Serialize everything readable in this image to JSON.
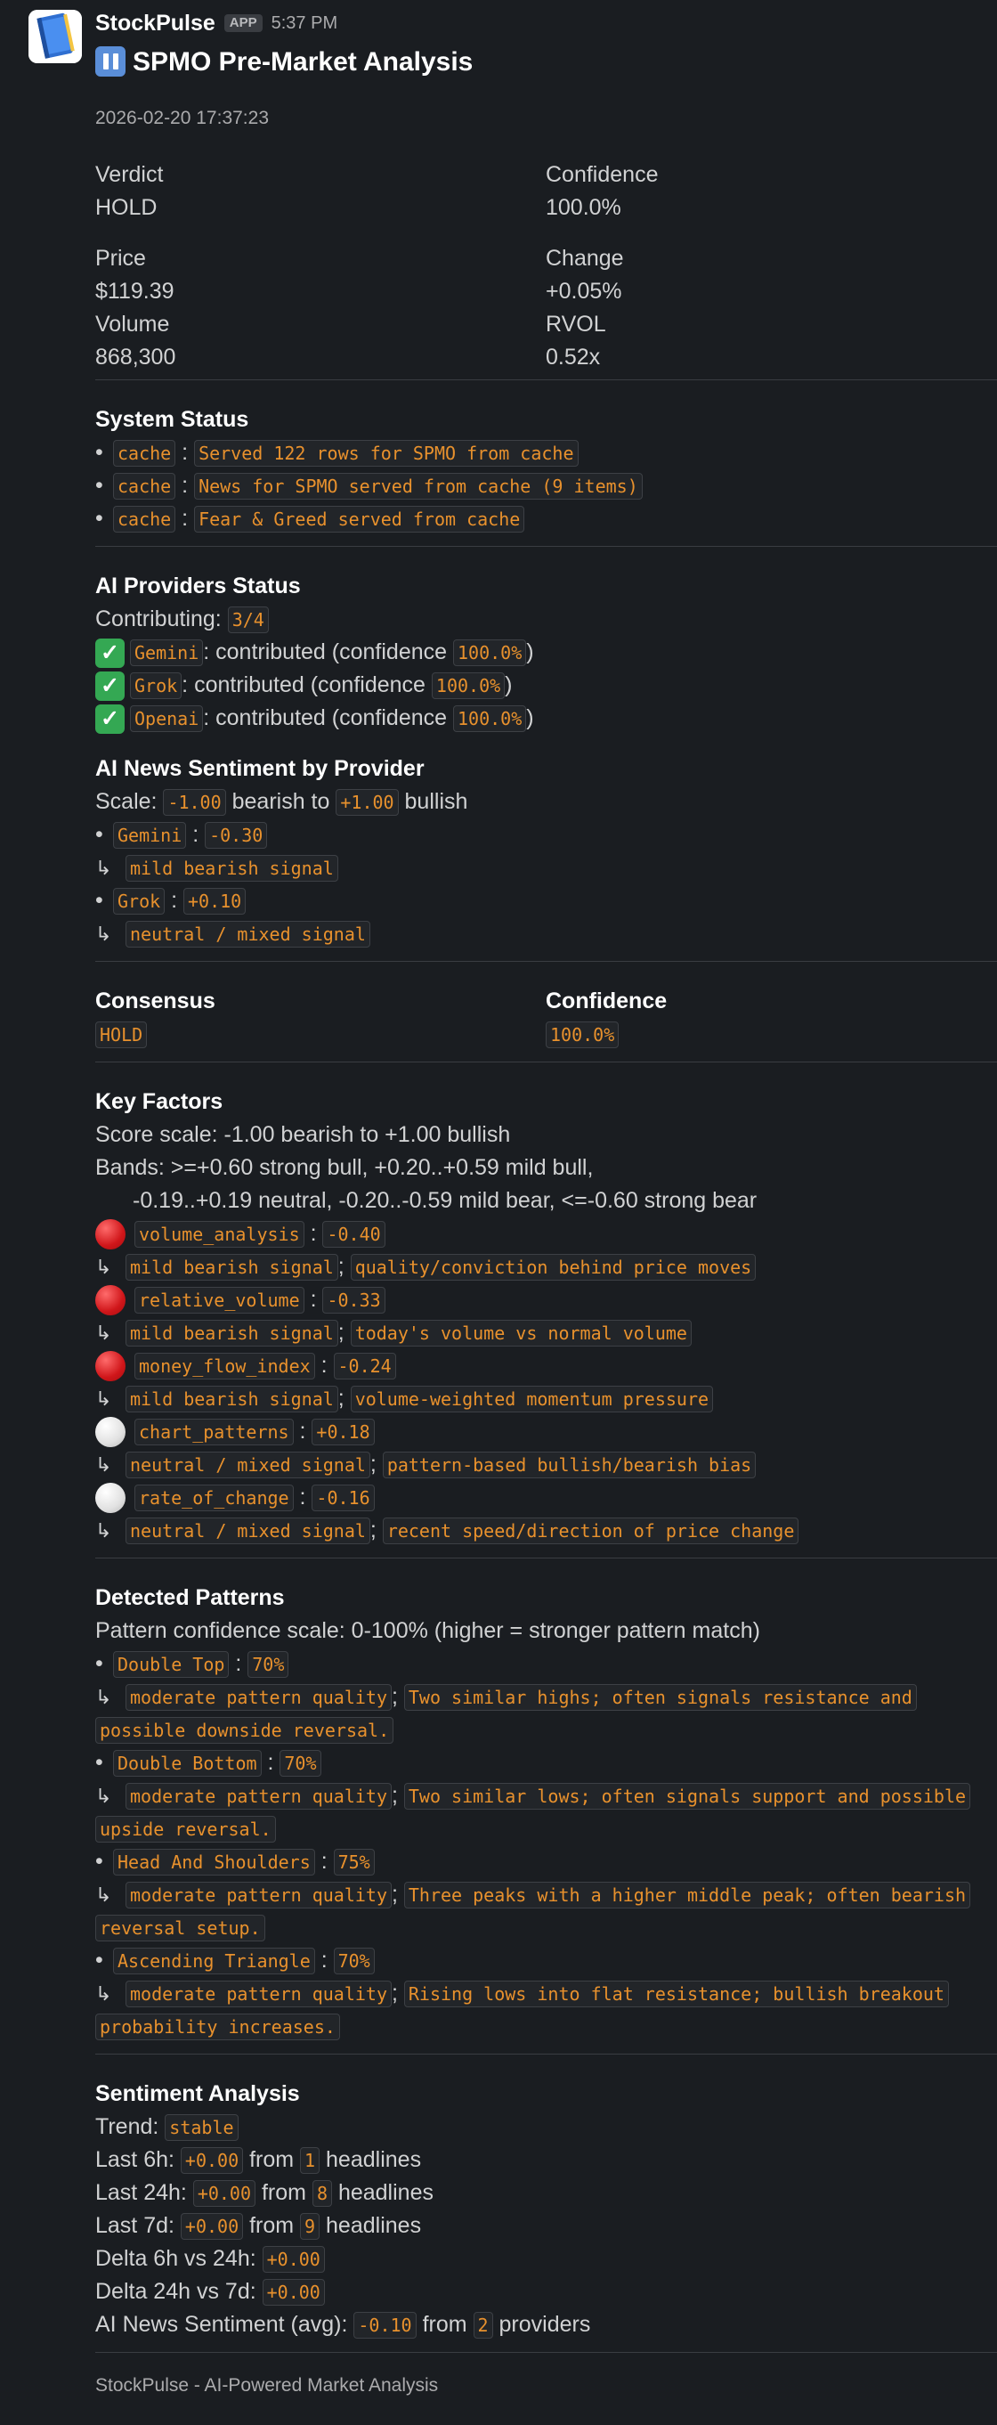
{
  "app": {
    "name": "StockPulse",
    "badge": "APP",
    "time": "5:37 PM",
    "avatar_icon": "book-icon"
  },
  "title": "SPMO Pre-Market Analysis",
  "title_icon": "pause-button-icon",
  "timestamp": "2026-02-20 17:37:23",
  "fields": {
    "verdict_label": "Verdict",
    "verdict": "HOLD",
    "confidence_label": "Confidence",
    "confidence": "100.0%",
    "price_label": "Price",
    "price": "$119.39",
    "change_label": "Change",
    "change": "+0.05%",
    "volume_label": "Volume",
    "volume": "868,300",
    "rvol_label": "RVOL",
    "rvol": "0.52x"
  },
  "system_status": {
    "title": "System Status",
    "items": [
      {
        "tag": "cache",
        "text": "Served 122 rows for SPMO from cache"
      },
      {
        "tag": "cache",
        "text": "News for SPMO served from cache (9 items)"
      },
      {
        "tag": "cache",
        "text": "Fear & Greed served from cache"
      }
    ]
  },
  "ai_providers": {
    "title": "AI Providers Status",
    "contributing_label": "Contributing:",
    "contributing": "3/4",
    "items": [
      {
        "name": "Gemini",
        "text": ": contributed (confidence",
        "confidence": "100.0%",
        "close": ")"
      },
      {
        "name": "Grok",
        "text": ": contributed (confidence",
        "confidence": "100.0%",
        "close": ")"
      },
      {
        "name": "Openai",
        "text": ": contributed (confidence",
        "confidence": "100.0%",
        "close": ")"
      }
    ]
  },
  "news_sentiment": {
    "title": "AI News Sentiment by Provider",
    "scale_label": "Scale:",
    "scale_min": "-1.00",
    "scale_mid": "bearish to",
    "scale_max": "+1.00",
    "scale_end": "bullish",
    "items": [
      {
        "name": "Gemini",
        "score": "-0.30",
        "signal": "mild bearish signal"
      },
      {
        "name": "Grok",
        "score": "+0.10",
        "signal": "neutral / mixed signal"
      }
    ]
  },
  "consensus": {
    "consensus_label": "Consensus",
    "consensus": "HOLD",
    "confidence_label": "Confidence",
    "confidence": "100.0%"
  },
  "key_factors": {
    "title": "Key Factors",
    "scale": "Score scale: -1.00 bearish to +1.00 bullish",
    "bands1": "Bands: >=+0.60 strong bull, +0.20..+0.59 mild bull,",
    "bands2": "-0.19..+0.19 neutral, -0.20..-0.59 mild bear, <=-0.60 strong bear",
    "items": [
      {
        "icon": "red-circle-icon",
        "name": "volume_analysis",
        "score": "-0.40",
        "signal": "mild bearish signal",
        "desc": "quality/conviction behind price moves"
      },
      {
        "icon": "red-circle-icon",
        "name": "relative_volume",
        "score": "-0.33",
        "signal": "mild bearish signal",
        "desc": "today's volume vs normal volume"
      },
      {
        "icon": "red-circle-icon",
        "name": "money_flow_index",
        "score": "-0.24",
        "signal": "mild bearish signal",
        "desc": "volume-weighted momentum pressure"
      },
      {
        "icon": "white-circle-icon",
        "name": "chart_patterns",
        "score": "+0.18",
        "signal": "neutral / mixed signal",
        "desc": "pattern-based bullish/bearish bias"
      },
      {
        "icon": "white-circle-icon",
        "name": "rate_of_change",
        "score": "-0.16",
        "signal": "neutral / mixed signal",
        "desc": "recent speed/direction of price change"
      }
    ]
  },
  "patterns": {
    "title": "Detected Patterns",
    "scale": "Pattern confidence scale: 0-100% (higher = stronger pattern match)",
    "items": [
      {
        "name": "Double Top",
        "pct": "70%",
        "quality": "moderate pattern quality",
        "desc_a": "Two similar highs; often signals resistance and",
        "desc_b": "possible downside reversal."
      },
      {
        "name": "Double Bottom",
        "pct": "70%",
        "quality": "moderate pattern quality",
        "desc_a": "Two similar lows; often signals support and possible",
        "desc_b": "upside reversal."
      },
      {
        "name": "Head And Shoulders",
        "pct": "75%",
        "quality": "moderate pattern quality",
        "desc_a": "Three peaks with a higher middle peak; often bearish",
        "desc_b": "reversal setup."
      },
      {
        "name": "Ascending Triangle",
        "pct": "70%",
        "quality": "moderate pattern quality",
        "desc_a": "Rising lows into flat resistance; bullish breakout",
        "desc_b": "probability increases."
      }
    ]
  },
  "sentiment": {
    "title": "Sentiment Analysis",
    "trend_label": "Trend:",
    "trend": "stable",
    "rows": [
      {
        "label": "Last 6h:",
        "value": "+0.00",
        "from": "from",
        "count": "1",
        "suffix": "headlines"
      },
      {
        "label": "Last 24h:",
        "value": "+0.00",
        "from": "from",
        "count": "8",
        "suffix": "headlines"
      },
      {
        "label": "Last 7d:",
        "value": "+0.00",
        "from": "from",
        "count": "9",
        "suffix": "headlines"
      }
    ],
    "delta1_label": "Delta 6h vs 24h:",
    "delta1": "+0.00",
    "delta2_label": "Delta 24h vs 7d:",
    "delta2": "+0.00",
    "avg_label": "AI News Sentiment (avg):",
    "avg": "-0.10",
    "avg_from": "from",
    "avg_count": "2",
    "avg_suffix": "providers"
  },
  "footer": "StockPulse - AI-Powered Market Analysis",
  "colors": {
    "background": "#1a1d21",
    "code_text": "#e8912d",
    "text": "#d1d2d3"
  }
}
